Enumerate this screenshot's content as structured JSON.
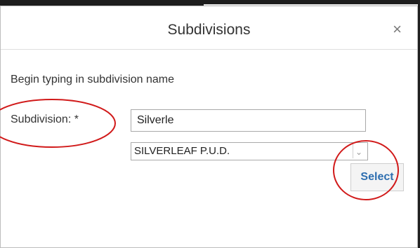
{
  "dialog": {
    "title": "Subdivisions",
    "close_label": "×",
    "instruction": "Begin typing in subdivision name"
  },
  "form": {
    "subdivision_label": "Subdivision: *",
    "subdivision_value": "Silverle",
    "selected_option": "SILVERLEAF P.U.D.",
    "select_arrow": "⌄",
    "select_button_label": "Select"
  },
  "colors": {
    "annotation_circle": "#d11a1a",
    "link_blue": "#2f6fb0"
  }
}
